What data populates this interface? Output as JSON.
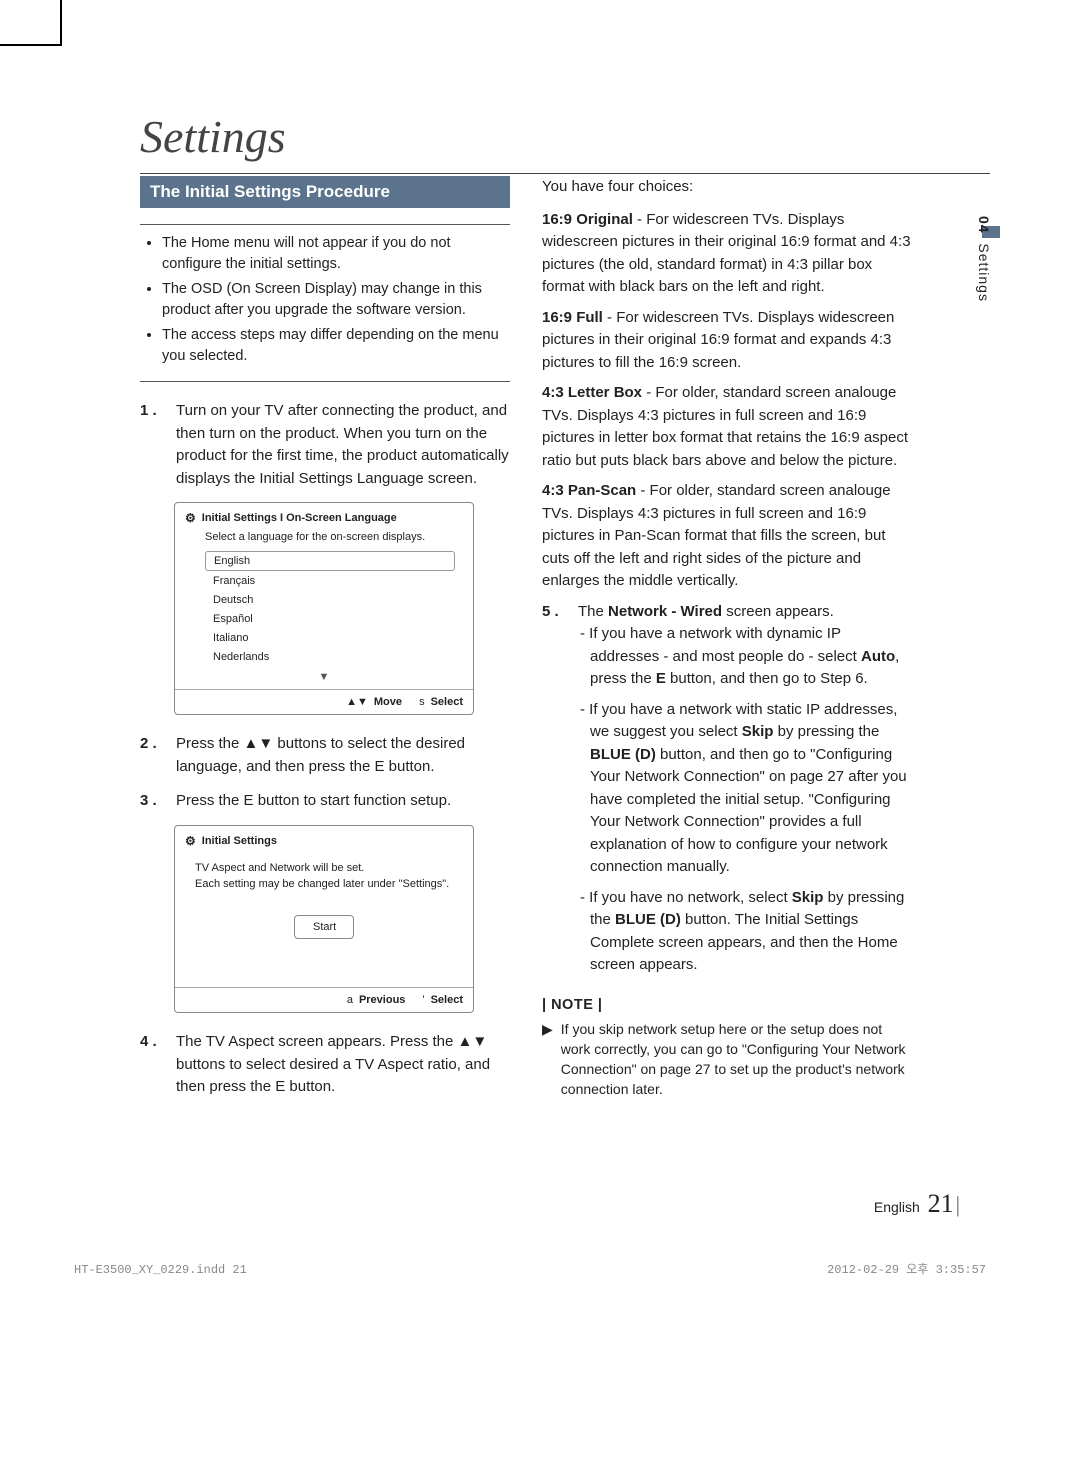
{
  "page": {
    "title": "Settings",
    "section_number": "04",
    "section_label": "Settings",
    "language_label": "English",
    "page_number": "21",
    "footer_left": "HT-E3500_XY_0229.indd   21",
    "footer_right": "2012-02-29   오후 3:35:57"
  },
  "band": "The Initial Settings Procedure",
  "warnings": [
    "The Home menu will not appear if you do not configure the initial settings.",
    "The OSD (On Screen Display) may change in this product after you upgrade the software version.",
    "The access steps may differ depending on the menu you selected."
  ],
  "steps": {
    "s1": {
      "num": "1 .",
      "text": "Turn on your TV after connecting the product, and then turn on the product. When you turn on the product for the first time, the product automatically displays the Initial Settings Language screen."
    },
    "s2": {
      "num": "2 .",
      "text": "Press the ▲▼ buttons to select the desired language, and then press the E button."
    },
    "s3": {
      "num": "3 .",
      "text": "Press the E button to start function setup."
    },
    "s4": {
      "num": "4 .",
      "text": "The TV Aspect screen appears. Press the ▲▼ buttons to select desired a TV Aspect ratio, and then press the E button."
    },
    "s5": {
      "num": "5 .",
      "pre": "The ",
      "bold": "Network - Wired",
      "post": " screen appears."
    }
  },
  "panel1": {
    "title": "Initial Settings I On-Screen Language",
    "subtitle": "Select a language for the on-screen displays.",
    "languages": [
      "English",
      "Français",
      "Deutsch",
      "Español",
      "Italiano",
      "Nederlands"
    ],
    "foot_move_sym": "▲▼",
    "foot_move": "Move",
    "foot_select_sym": "s",
    "foot_select": "Select"
  },
  "panel2": {
    "title": "Initial Settings",
    "line1": "TV Aspect and Network will be set.",
    "line2": "Each setting may be changed later under \"Settings\".",
    "start": "Start",
    "foot_prev_sym": "a",
    "foot_prev": "Previous",
    "foot_select_sym": "'",
    "foot_select": "Select"
  },
  "right": {
    "intro": "You have four choices:",
    "aspects": [
      {
        "label": "16:9 Original",
        "desc": " - For widescreen TVs. Displays widescreen pictures in their original 16:9 format and 4:3 pictures (the old, standard format) in 4:3 pillar box format with black bars on the left and right."
      },
      {
        "label": "16:9 Full",
        "desc": " - For widescreen TVs. Displays widescreen pictures in their original 16:9 format and expands 4:3 pictures to fill the 16:9 screen."
      },
      {
        "label": "4:3 Letter Box",
        "desc": " - For older, standard screen analouge TVs. Displays 4:3 pictures in full screen and 16:9 pictures in letter box format that retains the 16:9 aspect ratio but puts black bars above and below the picture."
      },
      {
        "label": "4:3 Pan-Scan",
        "desc": " - For older, standard screen analouge TVs. Displays 4:3 pictures in full screen and 16:9 pictures in Pan-Scan format that fills the screen, but cuts off the left and right sides of the picture and enlarges the middle vertically."
      }
    ],
    "sub1": {
      "pre": "If you have a network with dynamic IP addresses - and most people do - select ",
      "b1": "Auto",
      "mid": ", press the ",
      "b2": "E",
      "post": " button, and then go to Step 6."
    },
    "sub2": {
      "pre": "If you have a network with static IP addresses, we suggest you select ",
      "b1": "Skip",
      "mid1": " by pressing the ",
      "b2": "BLUE (D)",
      "post": " button, and then go to \"Configuring Your Network Connection\" on page 27 after you have completed the initial setup. \"Configuring Your Network Connection\" provides a full explanation of how to configure your network connection manually."
    },
    "sub3": {
      "pre": "If you have no network, select ",
      "b1": "Skip",
      "mid1": " by pressing the ",
      "b2": "BLUE (D)",
      "post": " button. The Initial Settings Complete screen appears, and then the Home screen appears."
    },
    "note_hdr": "| NOTE |",
    "note": "If you skip network setup here or the setup does not work correctly, you can go to \"Configuring Your Network Connection\" on page 27 to set up the product's network connection later."
  }
}
